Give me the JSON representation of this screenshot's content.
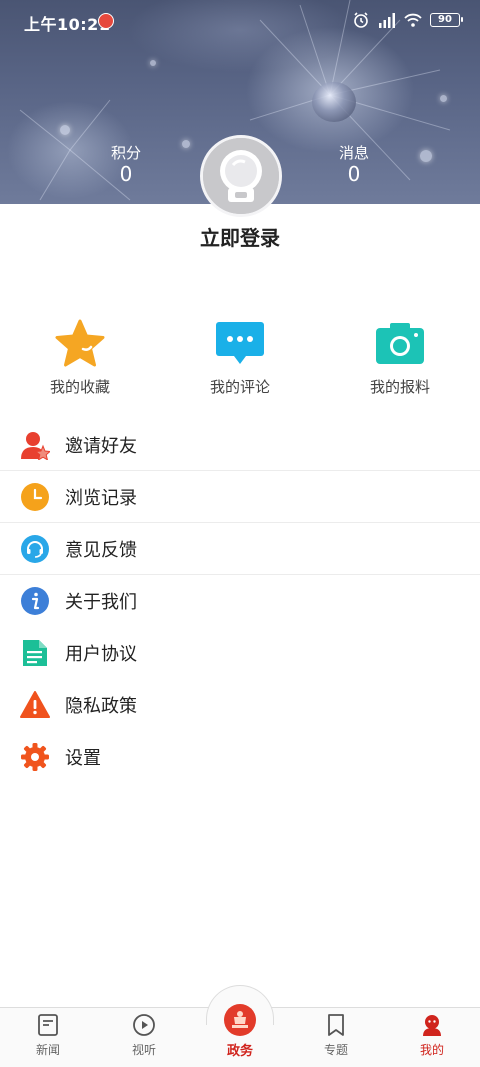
{
  "status_bar": {
    "time": "上午10:21",
    "battery": "90",
    "icons": [
      "alarm-icon",
      "hd-signal-icon",
      "wifi-icon",
      "battery-icon"
    ]
  },
  "header": {
    "points": {
      "label": "积分",
      "value": "0"
    },
    "messages": {
      "label": "消息",
      "value": "0"
    },
    "login_label": "立即登录"
  },
  "quick_actions": [
    {
      "label": "我的收藏",
      "icon": "star-icon",
      "color": "#f5a623"
    },
    {
      "label": "我的评论",
      "icon": "comment-icon",
      "color": "#1ab0e8"
    },
    {
      "label": "我的报料",
      "icon": "camera-icon",
      "color": "#1cc3b6"
    }
  ],
  "menu": [
    {
      "label": "邀请好友",
      "icon": "invite-friend-icon",
      "color": "#e8402f"
    },
    {
      "label": "浏览记录",
      "icon": "clock-icon",
      "color": "#f5a21b"
    },
    {
      "label": "意见反馈",
      "icon": "headset-icon",
      "color": "#29a7e8"
    },
    {
      "label": "关于我们",
      "icon": "info-icon",
      "color": "#3d7fd8"
    },
    {
      "label": "用户协议",
      "icon": "document-icon",
      "color": "#1cbf97"
    },
    {
      "label": "隐私政策",
      "icon": "warning-icon",
      "color": "#f0521d"
    },
    {
      "label": "设置",
      "icon": "gear-icon",
      "color": "#f0541d"
    }
  ],
  "tabbar": {
    "items": [
      {
        "label": "新闻",
        "icon": "news-icon"
      },
      {
        "label": "视听",
        "icon": "play-icon"
      },
      {
        "label": "政务",
        "icon": "gov-icon"
      },
      {
        "label": "专题",
        "icon": "bookmark-icon"
      },
      {
        "label": "我的",
        "icon": "mine-icon"
      }
    ],
    "active_color": "#d0241d"
  }
}
